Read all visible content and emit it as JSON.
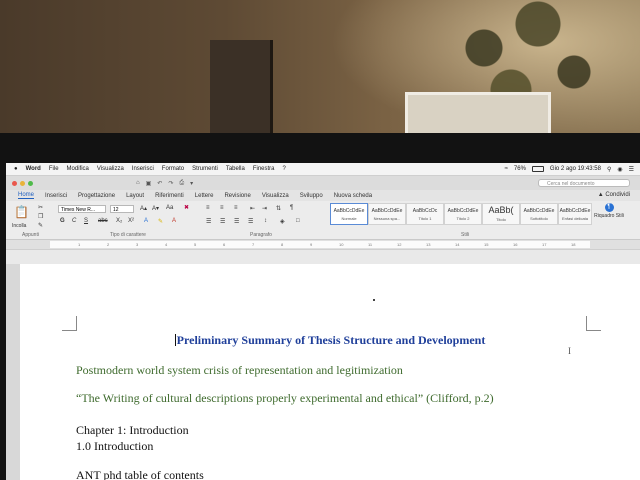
{
  "menubar": {
    "app": "Word",
    "items": [
      "File",
      "Modifica",
      "Visualizza",
      "Inserisci",
      "Formato",
      "Strumenti",
      "Tabella",
      "Finestra",
      "?"
    ],
    "battery": "76%",
    "datetime": "Gio 2 ago  19:43:58"
  },
  "titlebar": {
    "search_placeholder": "Cerca nel documento"
  },
  "tabs": {
    "items": [
      "Home",
      "Inserisci",
      "Progettazione",
      "Layout",
      "Riferimenti",
      "Lettere",
      "Revisione",
      "Visualizza",
      "Sviluppo",
      "Nuova scheda"
    ],
    "share": "Condividi"
  },
  "ribbon": {
    "paste": "Incolla",
    "font_name": "Times New R...",
    "font_size": "12",
    "group_clipboard": "Appunti",
    "group_font": "Tipo di carattere",
    "group_paragraph": "Paragrafo",
    "group_styles": "Stili",
    "styles": [
      {
        "preview": "AaBbCcDdEe",
        "name": "Normale"
      },
      {
        "preview": "AaBbCcDdEe",
        "name": "Nessuna spa..."
      },
      {
        "preview": "AaBbCcDc",
        "name": "Titolo 1"
      },
      {
        "preview": "AaBbCcDdEe",
        "name": "Titolo 2"
      },
      {
        "preview": "AaBb(",
        "name": "Titolo"
      },
      {
        "preview": "AaBbCcDdEe",
        "name": "Sottotitolo"
      },
      {
        "preview": "AaBbCcDdEe",
        "name": "Enfasi delicata"
      }
    ],
    "styles_pane": "Riquadro Stili"
  },
  "ruler": {
    "ticks": [
      "1",
      "2",
      "3",
      "4",
      "5",
      "6",
      "7",
      "8",
      "9",
      "10",
      "11",
      "12",
      "13",
      "14",
      "15",
      "16",
      "17",
      "18"
    ]
  },
  "document": {
    "title": "Preliminary Summary of Thesis Structure and Development",
    "line1": "Postmodern world system crisis of representation and legitimization",
    "line2": "“The Writing of cultural descriptions properly experimental and ethical” (Clifford, p.2)",
    "line3": "Chapter 1: Introduction",
    "line4": "1.0 Introduction",
    "line5": "ANT phd table of contents"
  },
  "colors": {
    "title_blue": "#1f3f9a",
    "quote_green": "#3f6b2e",
    "accent": "#1f5fbf"
  }
}
